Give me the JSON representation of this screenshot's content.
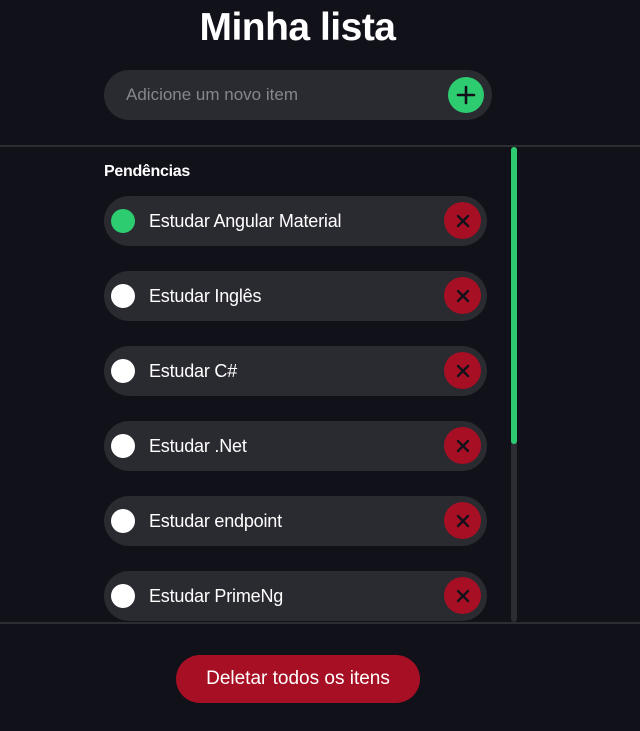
{
  "app": {
    "title": "Minha lista"
  },
  "add_item": {
    "placeholder": "Adicione um novo item",
    "value": "",
    "button_icon": "plus-icon"
  },
  "pending": {
    "heading": "Pendências",
    "items": [
      {
        "label": "Estudar Angular Material",
        "checked": true
      },
      {
        "label": "Estudar Inglês",
        "checked": false
      },
      {
        "label": "Estudar C#",
        "checked": false
      },
      {
        "label": "Estudar .Net",
        "checked": false
      },
      {
        "label": "Estudar endpoint",
        "checked": false
      },
      {
        "label": "Estudar PrimeNg",
        "checked": false
      }
    ],
    "delete_icon": "close-icon"
  },
  "footer": {
    "delete_all_label": "Deletar todos os itens"
  },
  "colors": {
    "background": "#11111a",
    "surface": "#2a2a31",
    "accent_green": "#2ecc71",
    "danger_red": "#a70f24",
    "divider": "#2c2c33"
  }
}
